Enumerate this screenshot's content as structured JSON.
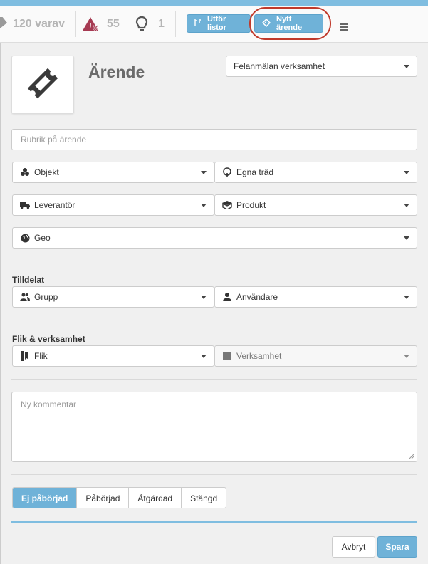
{
  "topbar": {
    "tickets_count": "120 varav",
    "alerts_count": "55",
    "ideas_count": "1",
    "run_lists_label": "Utför listor",
    "new_ticket_label": "Nytt ärende"
  },
  "form": {
    "title": "Ärende",
    "category_select": "Felanmälan verksamhet",
    "subject_placeholder": "Rubrik på ärende",
    "object_label": "Objekt",
    "own_trees_label": "Egna träd",
    "supplier_label": "Leverantör",
    "product_label": "Produkt",
    "geo_label": "Geo",
    "assigned_section": "Tilldelat",
    "group_label": "Grupp",
    "user_label": "Användare",
    "tab_section": "Flik & verksamhet",
    "tab_label": "Flik",
    "business_label": "Verksamhet",
    "comment_placeholder": "Ny kommentar"
  },
  "status": {
    "options": [
      "Ej påbörjad",
      "Påbörjad",
      "Åtgärdad",
      "Stängd"
    ],
    "selected": "Ej påbörjad"
  },
  "actions": {
    "cancel_label": "Avbryt",
    "save_label": "Spara"
  },
  "colors": {
    "accent": "#6fb2d8",
    "highlight_ring": "#c0392b",
    "alert": "#a63a52"
  }
}
